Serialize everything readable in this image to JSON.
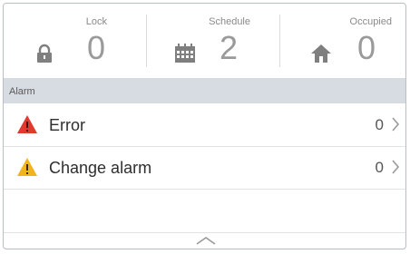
{
  "stats": {
    "lock": {
      "label": "Lock",
      "value": "0",
      "icon": "lock-icon"
    },
    "schedule": {
      "label": "Schedule",
      "value": "2",
      "icon": "calendar-icon"
    },
    "occupied": {
      "label": "Occupied",
      "value": "0",
      "icon": "home-icon"
    }
  },
  "section": {
    "title": "Alarm"
  },
  "alarms": [
    {
      "label": "Error",
      "count": "0",
      "icon": "error-triangle-icon",
      "color": "#e03a2f"
    },
    {
      "label": "Change alarm",
      "count": "0",
      "icon": "warning-triangle-icon",
      "color": "#f2b41c"
    }
  ],
  "colors": {
    "header_bg": "#d7dce3",
    "icon_gray": "#7f7f7f",
    "number_gray": "#9a9a9a"
  }
}
